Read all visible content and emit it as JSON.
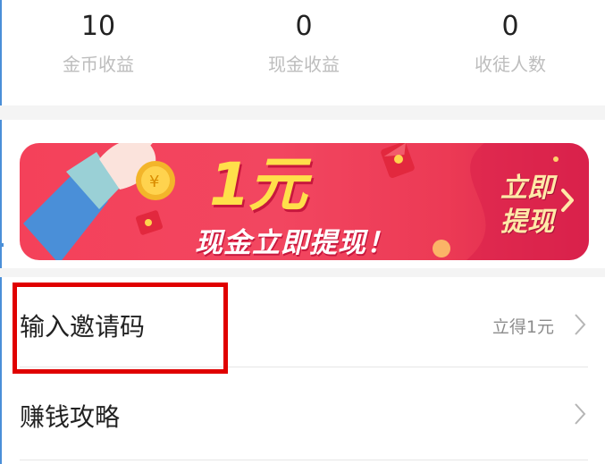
{
  "stats": [
    {
      "value": "10",
      "label": "金币收益"
    },
    {
      "value": "0",
      "label": "现金收益"
    },
    {
      "value": "0",
      "label": "收徒人数"
    }
  ],
  "banner": {
    "amount": "1元",
    "tagline": "现金立即提现！",
    "cta_line1": "立即",
    "cta_line2": "提现",
    "icons": [
      "hand-holding-coin-icon",
      "red-envelope-icon",
      "chevron-right-icon"
    ]
  },
  "list": [
    {
      "title": "输入邀请码",
      "hint": "立得1元"
    },
    {
      "title": "赚钱攻略",
      "hint": ""
    }
  ],
  "colors": {
    "banner_red": "#f24660",
    "amount_yellow": "#ffe04a",
    "highlight_red": "#e00000"
  }
}
